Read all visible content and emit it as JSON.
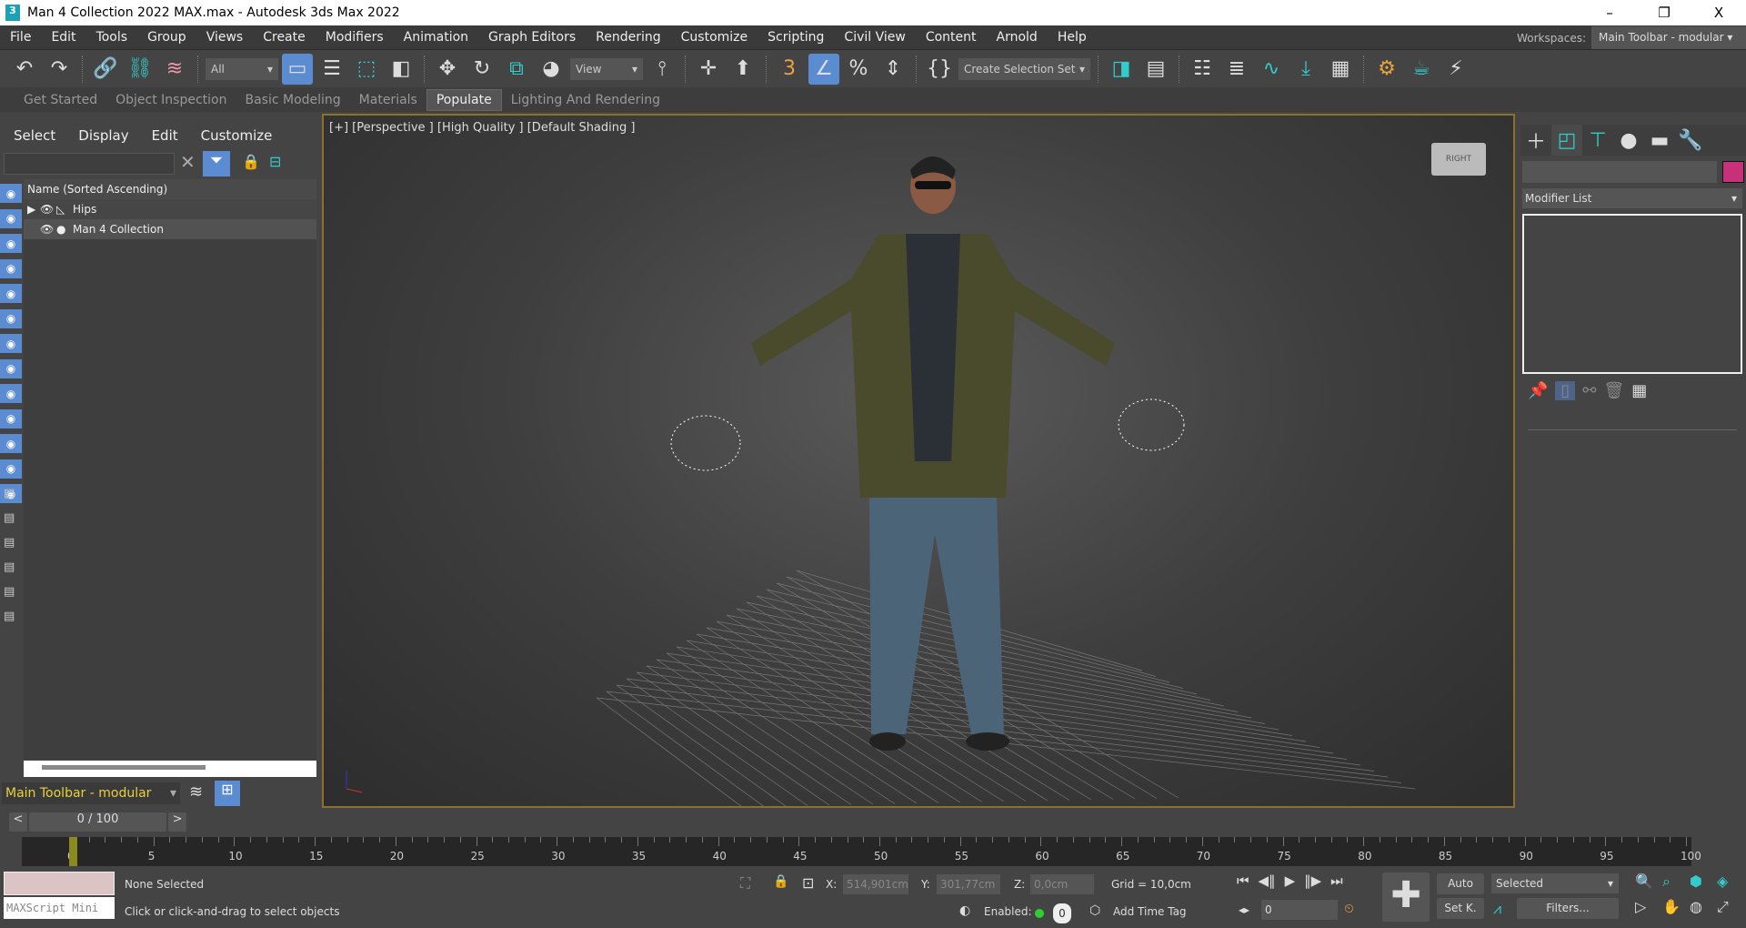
{
  "window": {
    "title": "Man 4 Collection 2022 MAX.max - Autodesk 3ds Max 2022",
    "logo": "3",
    "minimize": "–",
    "restore": "❐",
    "close": "X"
  },
  "menu": [
    "File",
    "Edit",
    "Tools",
    "Group",
    "Views",
    "Create",
    "Modifiers",
    "Animation",
    "Graph Editors",
    "Rendering",
    "Customize",
    "Scripting",
    "Civil View",
    "Content",
    "Arnold",
    "Help"
  ],
  "workspaces": {
    "label": "Workspaces:",
    "value": "Main Toolbar - modular"
  },
  "toolbar": {
    "filter": "All",
    "refcoord": "View",
    "selection_set": "Create Selection Set"
  },
  "ribbon_tabs": [
    "Get Started",
    "Object Inspection",
    "Basic Modeling",
    "Materials",
    "Populate",
    "Lighting And Rendering"
  ],
  "ribbon_active": "Populate",
  "scene_explorer": {
    "tabs": [
      "Select",
      "Display",
      "Edit",
      "Customize"
    ],
    "column": "Name (Sorted Ascending)",
    "rows": [
      "Hips",
      "Man 4 Collection"
    ],
    "layer_dropdown": "Main Toolbar - modular"
  },
  "viewport": {
    "label": "[+] [Perspective ] [High Quality ] [Default Shading ]",
    "viewcube": "RIGHT"
  },
  "command_panel": {
    "modifier_list": "Modifier List",
    "object_color": "#c8307a"
  },
  "timeline": {
    "frame": "0 / 100",
    "ticks": [
      "0",
      "5",
      "10",
      "15",
      "20",
      "25",
      "30",
      "35",
      "40",
      "45",
      "50",
      "55",
      "60",
      "65",
      "70",
      "75",
      "80",
      "85",
      "90",
      "95",
      "100"
    ]
  },
  "status": {
    "maxscript": "MAXScript Mini",
    "selection": "None Selected",
    "prompt": "Click or click-and-drag to select objects",
    "x_label": "X:",
    "x": "514,901cm",
    "y_label": "Y:",
    "y": "301,77cm",
    "z_label": "Z:",
    "z": "0,0cm",
    "grid": "Grid = 10,0cm",
    "enabled": "Enabled:",
    "tag_count": "0",
    "add_time_tag": "Add Time Tag",
    "current_frame": "0",
    "auto": "Auto",
    "set_key": "Set K.",
    "key_mode": "Selected",
    "filters": "Filters..."
  }
}
